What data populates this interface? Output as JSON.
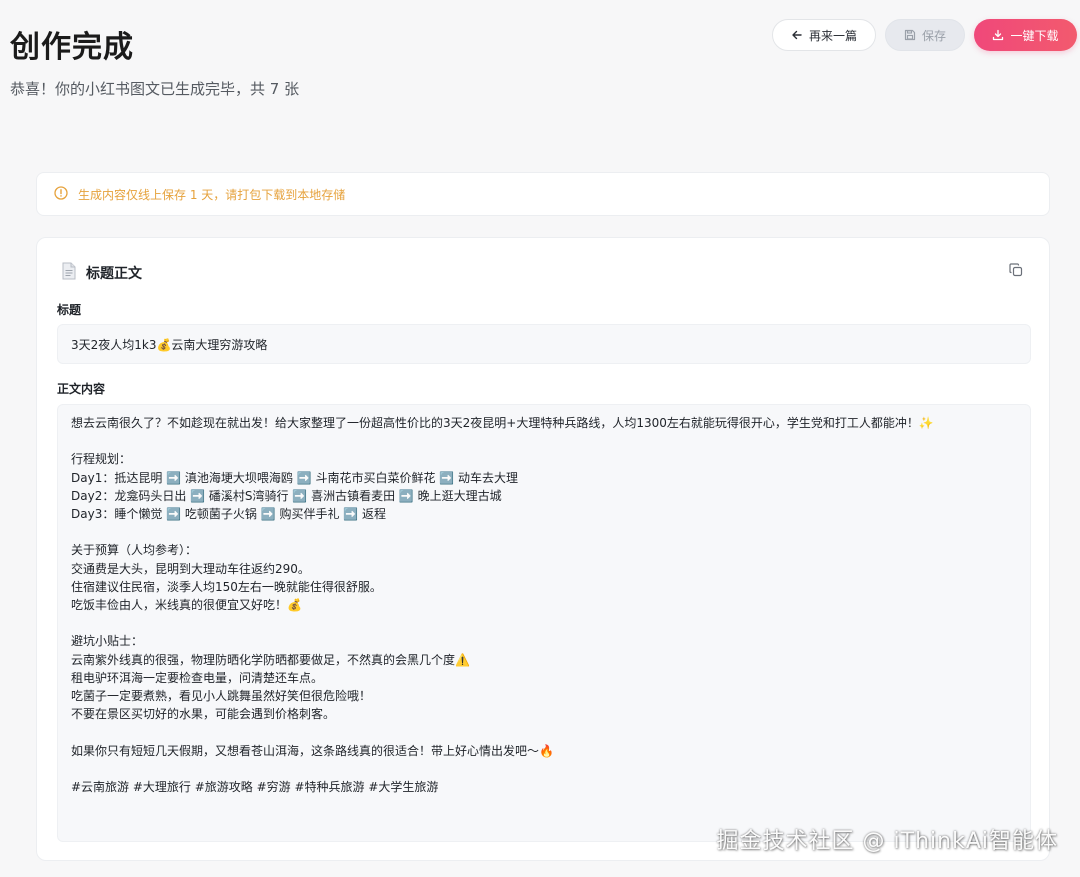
{
  "header": {
    "title": "创作完成",
    "subtitle": "恭喜！你的小红书图文已生成完毕，共 7 张"
  },
  "toolbar": {
    "again_label": "再来一篇",
    "save_label": "保存",
    "download_label": "一键下载"
  },
  "notice": {
    "text": "生成内容仅线上保存 1 天，请打包下载到本地存储"
  },
  "card": {
    "title": "标题正文",
    "title_label": "标题",
    "title_value": "3天2夜人均1k3💰云南大理穷游攻略",
    "body_label": "正文内容",
    "body_value": "想去云南很久了？不如趁现在就出发！给大家整理了一份超高性价比的3天2夜昆明+大理特种兵路线，人均1300左右就能玩得很开心，学生党和打工人都能冲！✨\n\n行程规划：\nDay1：抵达昆明 ➡️ 滇池海埂大坝喂海鸥 ➡️ 斗南花市买白菜价鲜花 ➡️ 动车去大理\nDay2：龙龛码头日出 ➡️ 磻溪村S湾骑行 ➡️ 喜洲古镇看麦田 ➡️ 晚上逛大理古城\nDay3：睡个懒觉 ➡️ 吃顿菌子火锅 ➡️ 购买伴手礼 ➡️ 返程\n\n关于预算（人均参考）：\n交通费是大头，昆明到大理动车往返约290。\n住宿建议住民宿，淡季人均150左右一晚就能住得很舒服。\n吃饭丰俭由人，米线真的很便宜又好吃！💰\n\n避坑小贴士：\n云南紫外线真的很强，物理防晒化学防晒都要做足，不然真的会黑几个度⚠️\n租电驴环洱海一定要检查电量，问清楚还车点。\n吃菌子一定要煮熟，看见小人跳舞虽然好笑但很危险哦！\n不要在景区买切好的水果，可能会遇到价格刺客。\n\n如果你只有短短几天假期，又想看苍山洱海，这条路线真的很适合！带上好心情出发吧～🔥\n\n#云南旅游 #大理旅行 #旅游攻略 #穷游 #特种兵旅游 #大学生旅游"
  },
  "watermark": "掘金技术社区 @ iThinkAi智能体",
  "colors": {
    "accent": "#f0487a",
    "warning": "#e6a23c",
    "background": "#f7f7f8"
  },
  "icons": {
    "again": "arrow-left-icon",
    "save": "save-icon",
    "download": "download-icon",
    "notice": "warning-circle-icon",
    "card": "document-icon",
    "copy": "copy-icon"
  }
}
